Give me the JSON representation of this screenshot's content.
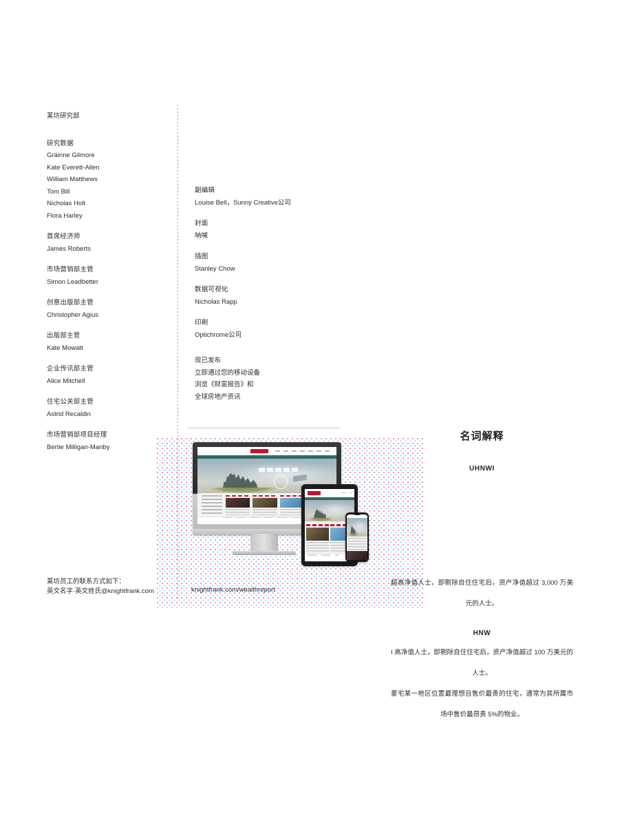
{
  "left_column": {
    "department": "莱坊研究部",
    "groups": [
      {
        "role": "研究数据",
        "people": [
          "Gráinne Gilmore",
          "Kate Everett-Allen",
          "William Matthews",
          "Tom Bill",
          "Nicholas Holt",
          "Flora Harley"
        ]
      },
      {
        "role": "首席经济师",
        "people": [
          "James Roberts"
        ]
      },
      {
        "role": "市场营销部主管",
        "people": [
          "Simon Leadbetter"
        ]
      },
      {
        "role": "创意出版部主管",
        "people": [
          "Christopher Agius"
        ]
      },
      {
        "role": "出版部主管",
        "people": [
          "Kate Mowatt"
        ]
      },
      {
        "role": "企业传讯部主管",
        "people": [
          "Alice Mitchell"
        ]
      },
      {
        "role": "住宅公关部主管",
        "people": [
          "Astrid Recaldin"
        ]
      },
      {
        "role": "市场营销部项目经理",
        "people": [
          "Bertie Milligan-Manby"
        ]
      }
    ],
    "contact_line_1": "莱坊员工的联系方式如下：",
    "contact_line_2": "英文名字·英文姓氏@knightfrank.com"
  },
  "middle_column": {
    "groups": [
      {
        "role": "副编辑",
        "people": [
          "Louise Bell，Sunny Creative公司"
        ]
      },
      {
        "role": "封面",
        "people": [
          "呐喊"
        ]
      },
      {
        "role": "插图",
        "people": [
          "Stanley Chow"
        ]
      },
      {
        "role": "数据可视化",
        "people": [
          "Nicholas Rapp"
        ]
      },
      {
        "role": "印刷",
        "people": [
          "Optichrome公司"
        ]
      }
    ],
    "promo": {
      "line_1": "现已发布",
      "line_2": "立即通过您的移动设备",
      "line_3": "浏览《财富报告》和",
      "line_4": "全球房地产资讯"
    },
    "url": "knightfrank.com/wealthreport"
  },
  "glossary": {
    "title": "名词解释",
    "entries": [
      {
        "term": "UHNWI",
        "definition": "超高净值人士，即剔除自住住宅后，资产净值超过 3,000 万美元的人士。"
      },
      {
        "term": "HNW",
        "definition": "I 高净值人士，即剔除自住住宅后，资产净值超过 100 万美元的人士。"
      },
      {
        "term": "",
        "definition": "豪宅某一地区位置最理想且售价最贵的住宅，通常为其所属市场中售价最昂贵 5%的物业。"
      }
    ]
  },
  "colors": {
    "brand_red": "#c8102e",
    "halftone_magenta": "#ec008c",
    "halftone_cyan": "#00aeef",
    "text": "#231f20"
  }
}
